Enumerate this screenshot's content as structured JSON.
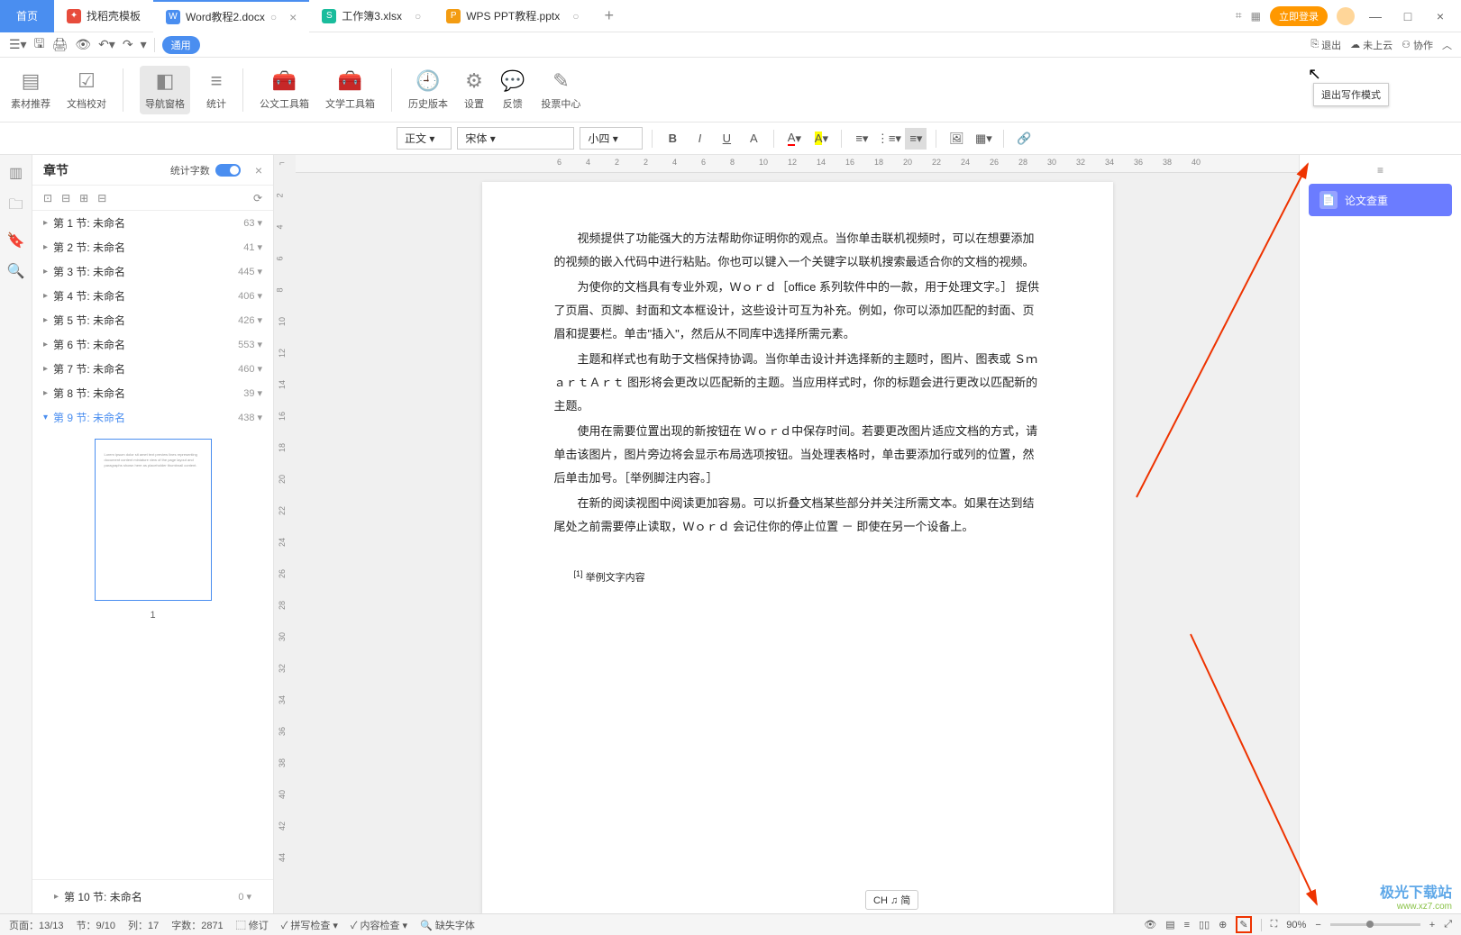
{
  "tabs": {
    "home": "首页",
    "template": "找稻壳模板",
    "doc_active": "Word教程2.docx",
    "xls": "工作簿3.xlsx",
    "ppt": "WPS PPT教程.pptx"
  },
  "title_right": {
    "login": "立即登录"
  },
  "quick_access": {
    "badge": "通用",
    "exit": "退出",
    "cloud": "未上云",
    "collab": "协作"
  },
  "tooltip_exit": "退出写作模式",
  "ribbon": {
    "material": "素材推荐",
    "proof": "文档校对",
    "nav": "导航窗格",
    "stats": "统计",
    "gov_tools": "公文工具箱",
    "lit_tools": "文学工具箱",
    "history": "历史版本",
    "settings": "设置",
    "feedback": "反馈",
    "vote": "投票中心"
  },
  "format": {
    "style": "正文",
    "font": "宋体",
    "size": "小四"
  },
  "chapter": {
    "title": "章节",
    "stats_label": "统计字数",
    "sections": [
      {
        "label": "第 1 节: 未命名",
        "count": "63"
      },
      {
        "label": "第 2 节: 未命名",
        "count": "41"
      },
      {
        "label": "第 3 节: 未命名",
        "count": "445"
      },
      {
        "label": "第 4 节: 未命名",
        "count": "406"
      },
      {
        "label": "第 5 节: 未命名",
        "count": "426"
      },
      {
        "label": "第 6 节: 未命名",
        "count": "553"
      },
      {
        "label": "第 7 节: 未命名",
        "count": "460"
      },
      {
        "label": "第 8 节: 未命名",
        "count": "39"
      },
      {
        "label": "第 9 节: 未命名",
        "count": "438"
      }
    ],
    "section_bottom": {
      "label": "第 10 节: 未命名",
      "count": "0"
    },
    "thumb_page": "1"
  },
  "ruler_h": [
    "6",
    "4",
    "2",
    "2",
    "4",
    "6",
    "8",
    "10",
    "12",
    "14",
    "16",
    "18",
    "20",
    "22",
    "24",
    "26",
    "28",
    "30",
    "32",
    "34",
    "36",
    "38",
    "40"
  ],
  "ruler_v": [
    "2",
    "4",
    "6",
    "8",
    "10",
    "12",
    "14",
    "16",
    "18",
    "20",
    "22",
    "24",
    "26",
    "28",
    "30",
    "32",
    "34",
    "36",
    "38",
    "40",
    "42",
    "44"
  ],
  "document": {
    "p1": "视频提供了功能强大的方法帮助你证明你的观点。当你单击联机视频时，可以在想要添加的视频的嵌入代码中进行粘贴。你也可以键入一个关键字以联机搜索最适合你的文档的视频。",
    "p2": "为使你的文档具有专业外观，Ｗｏｒｄ［office 系列软件中的一款，用于处理文字。］ 提供了页眉、页脚、封面和文本框设计，这些设计可互为补充。例如，你可以添加匹配的封面、页眉和提要栏。单击\"插入\"，然后从不同库中选择所需元素。",
    "p3": "主题和样式也有助于文档保持协调。当你单击设计并选择新的主题时，图片、图表或 ＳｍａｒｔＡｒｔ 图形将会更改以匹配新的主题。当应用样式时，你的标题会进行更改以匹配新的主题。",
    "p4": "使用在需要位置出现的新按钮在 Ｗｏｒｄ中保存时间。若要更改图片适应文档的方式，请单击该图片，图片旁边将会显示布局选项按钮。当处理表格时，单击要添加行或列的位置，然后单击加号。［举例脚注内容。］",
    "p5": "在新的阅读视图中阅读更加容易。可以折叠文档某些部分并关注所需文本。如果在达到结尾处之前需要停止读取，Ｗｏｒｄ  会记住你的停止位置  － 即使在另一个设备上。",
    "footnote": "举例文字内容",
    "footnote_mark": "[1]"
  },
  "right_panel": {
    "check": "论文查重"
  },
  "ime": "CH ♫ 简",
  "status": {
    "page": "页面：13/13",
    "section": "节：9/10",
    "line": "列：17",
    "words": "字数：2871",
    "edit": "修订",
    "spell": "拼写检查",
    "content": "内容检查",
    "font_missing": "缺失字体",
    "zoom": "90%"
  },
  "watermark": {
    "line1": "极光下载站",
    "line2": "www.xz7.com"
  }
}
